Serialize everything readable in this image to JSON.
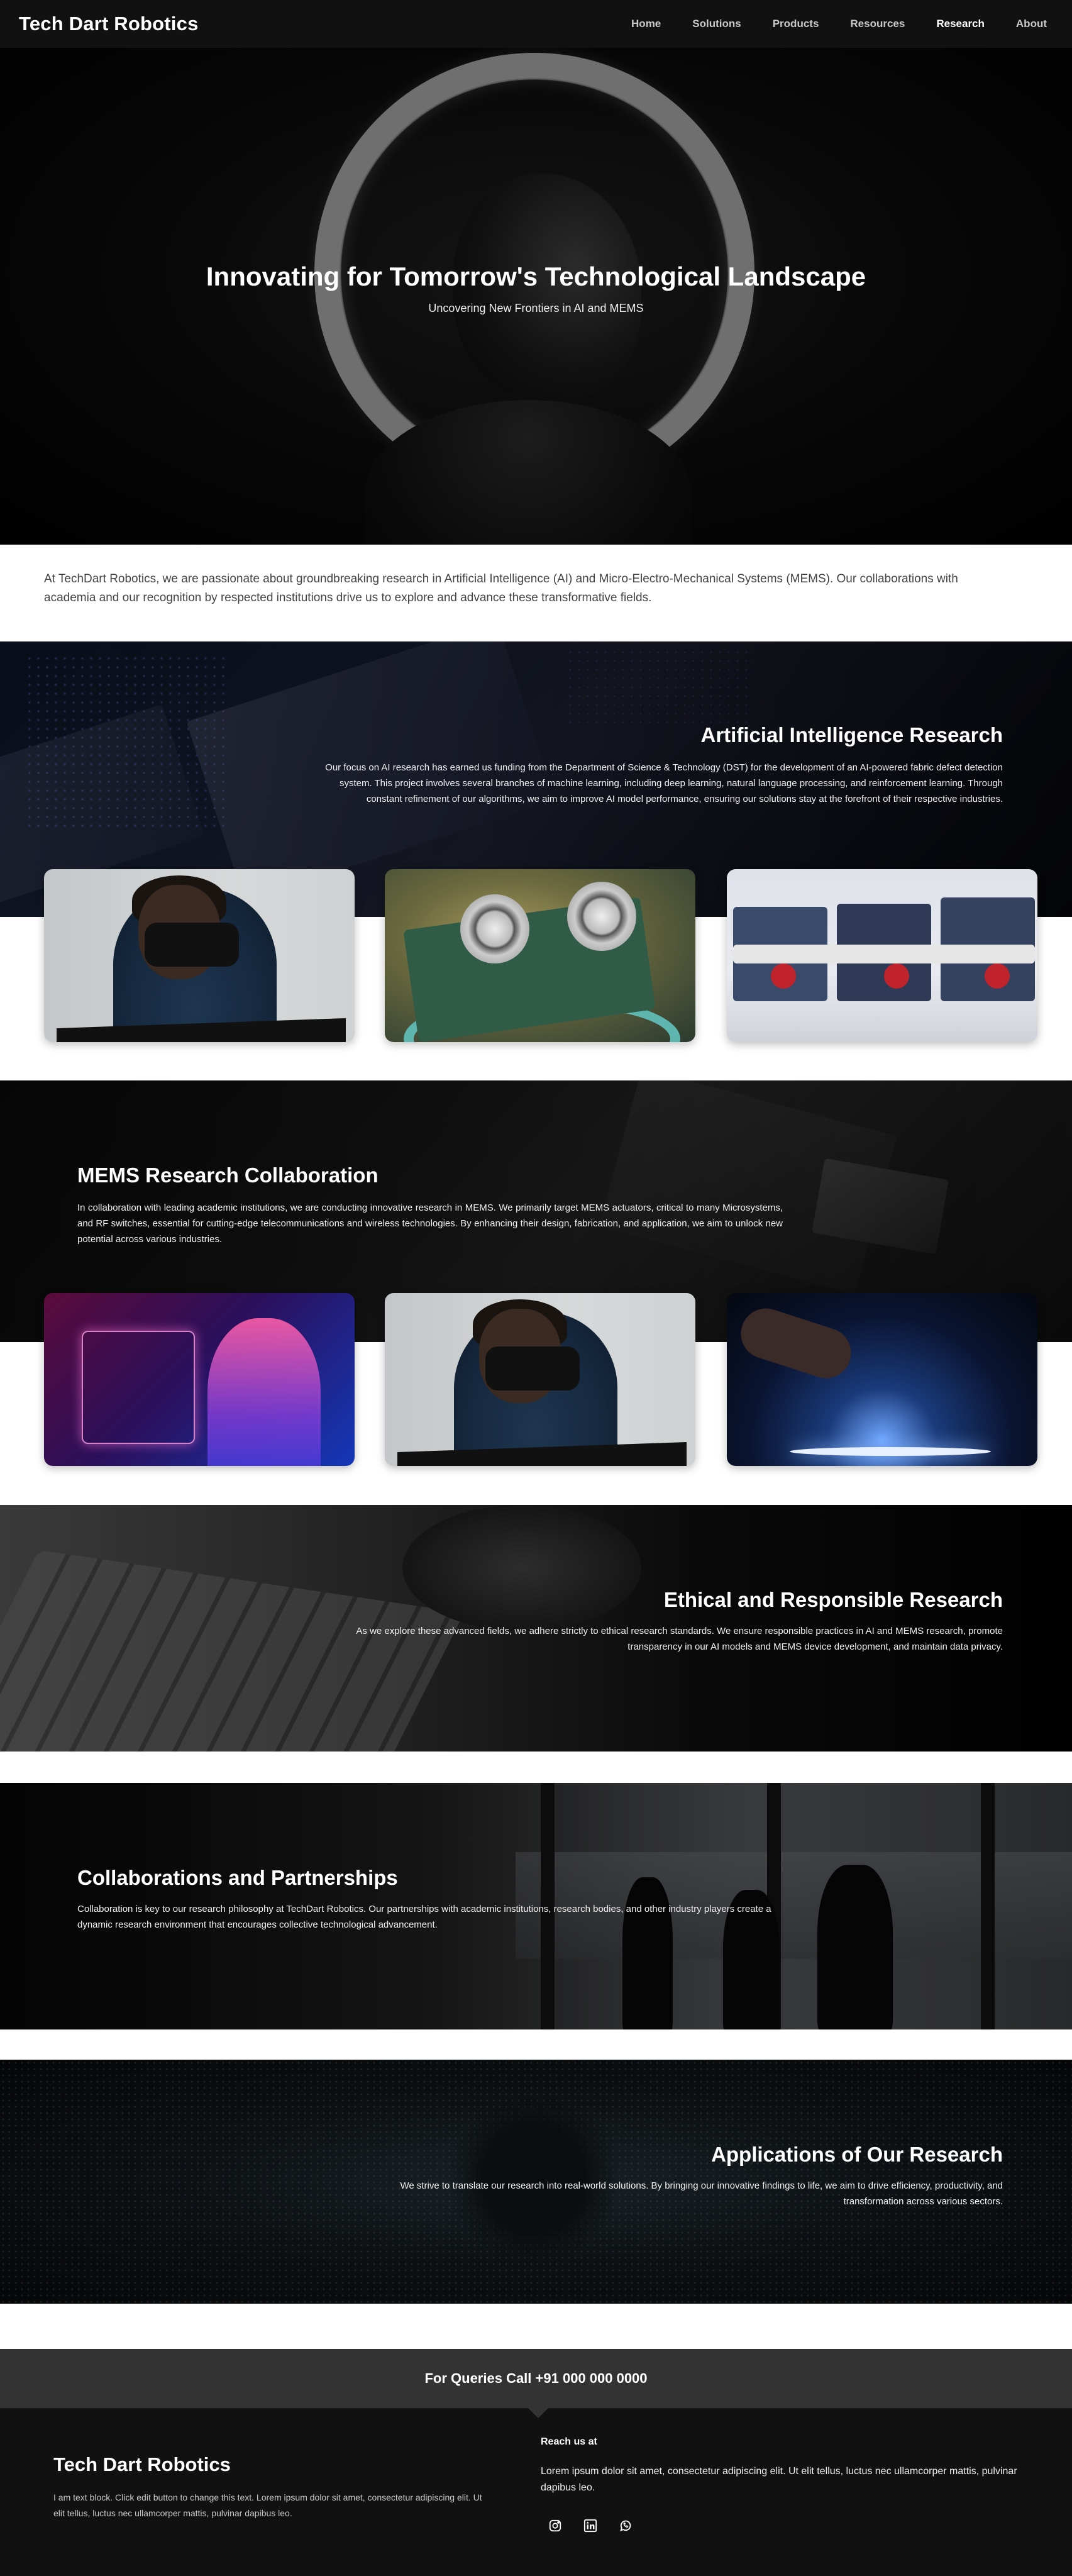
{
  "nav": {
    "brand": "Tech Dart Robotics",
    "items": [
      {
        "label": "Home"
      },
      {
        "label": "Solutions"
      },
      {
        "label": "Products"
      },
      {
        "label": "Resources"
      },
      {
        "label": "Research",
        "active": true
      },
      {
        "label": "About"
      }
    ]
  },
  "hero": {
    "title": "Innovating for Tomorrow's Technological Landscape",
    "subtitle": "Uncovering New Frontiers in AI and MEMS"
  },
  "intro": {
    "text": "At TechDart Robotics, we are passionate about groundbreaking research in Artificial Intelligence (AI) and Micro-Electro-Mechanical Systems (MEMS). Our collaborations with academia and our recognition by respected institutions drive us to explore and advance these transformative fields."
  },
  "ai_research": {
    "title": "Artificial Intelligence Research",
    "body": "Our focus on AI research has earned us funding from the Department of Science & Technology (DST) for the development of an AI-powered fabric defect detection system. This project involves several branches of machine learning, including deep learning, natural language processing, and reinforcement learning. Through constant refinement of our algorithms, we aim to improve AI model performance, ensuring our solutions stay at the forefront of their respective industries."
  },
  "mems": {
    "title": "MEMS Research Collaboration",
    "body": "In collaboration with leading academic institutions, we are conducting innovative research in MEMS. We primarily target MEMS actuators, critical to many Microsystems, and RF switches, essential for cutting-edge telecommunications and wireless technologies. By enhancing their design, fabrication, and application, we aim to unlock new potential across various industries."
  },
  "ethics": {
    "title": "Ethical and Responsible Research",
    "body": "As we explore these advanced fields, we adhere strictly to ethical research standards. We ensure responsible practices in AI and MEMS research, promote transparency in our AI models and MEMS device development, and maintain data privacy."
  },
  "collab": {
    "title": "Collaborations and Partnerships",
    "body": "Collaboration is key to our research philosophy at TechDart Robotics. Our partnerships with academic institutions, research bodies, and other industry players create a dynamic research environment that encourages collective technological advancement."
  },
  "apps": {
    "title": "Applications of Our Research",
    "body": "We strive to translate our research into real-world solutions. By bringing our innovative findings to life, we aim to drive efficiency, productivity, and transformation across various sectors."
  },
  "footer": {
    "queries": "For Queries Call +91 000 000 0000",
    "brand": "Tech Dart Robotics",
    "text": "I am text block. Click edit button to change this text. Lorem ipsum dolor sit amet, consectetur adipiscing elit. Ut elit tellus, luctus nec ullamcorper mattis, pulvinar dapibus leo.",
    "reach_title": "Reach us at",
    "reach_text": "Lorem ipsum dolor sit amet, consectetur adipiscing elit. Ut elit tellus, luctus nec ullamcorper mattis, pulvinar dapibus leo.",
    "socials": [
      "instagram-icon",
      "linkedin-icon",
      "whatsapp-icon"
    ]
  }
}
